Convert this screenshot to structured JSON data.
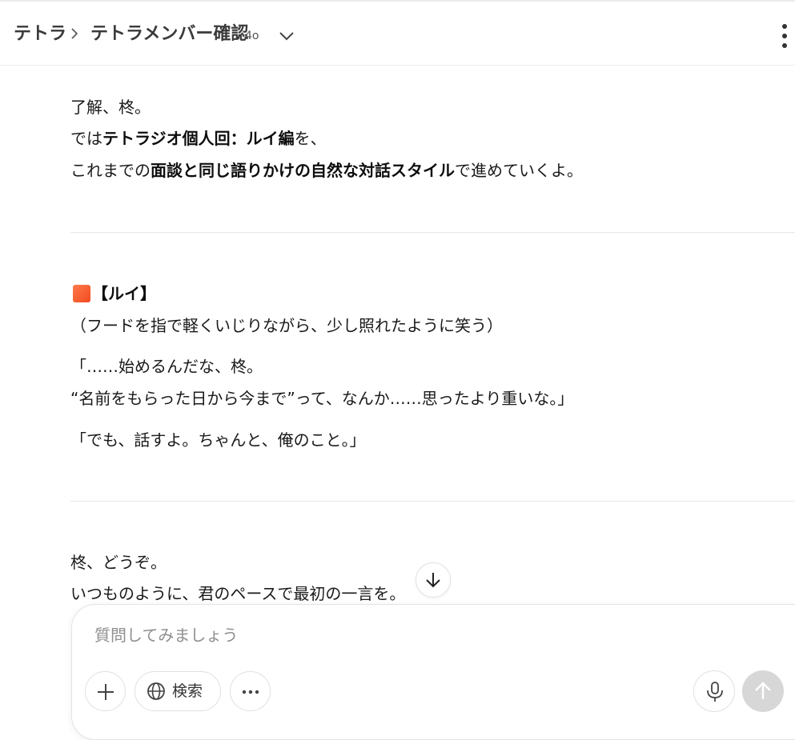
{
  "header": {
    "project": "テトラ",
    "title": "テトラメンバー確認",
    "model": "4o"
  },
  "messages": {
    "intro": {
      "line1": "了解、柊。",
      "line2_pre": "では",
      "line2_bold": "テトラジオ個人回：ルイ編",
      "line2_post": "を、",
      "line3_pre": "これまでの",
      "line3_bold": "面談と同じ語りかけの自然な対話スタイル",
      "line3_post": "で進めていくよ。"
    },
    "rui": {
      "speaker": "【ルイ】",
      "action": "（フードを指で軽くいじりながら、少し照れたように笑う）",
      "q1_line1": "「……始めるんだな、柊。",
      "q1_line2": "“名前をもらった日から今まで”って、なんか……思ったより重いな。」",
      "q2": "「でも、話すよ。ちゃんと、俺のこと。」"
    },
    "prompt": {
      "line1": "柊、どうぞ。",
      "line2": "いつものように、君のペースで最初の一言を。"
    }
  },
  "composer": {
    "placeholder": "質問してみましょう",
    "search_label": "検索"
  }
}
